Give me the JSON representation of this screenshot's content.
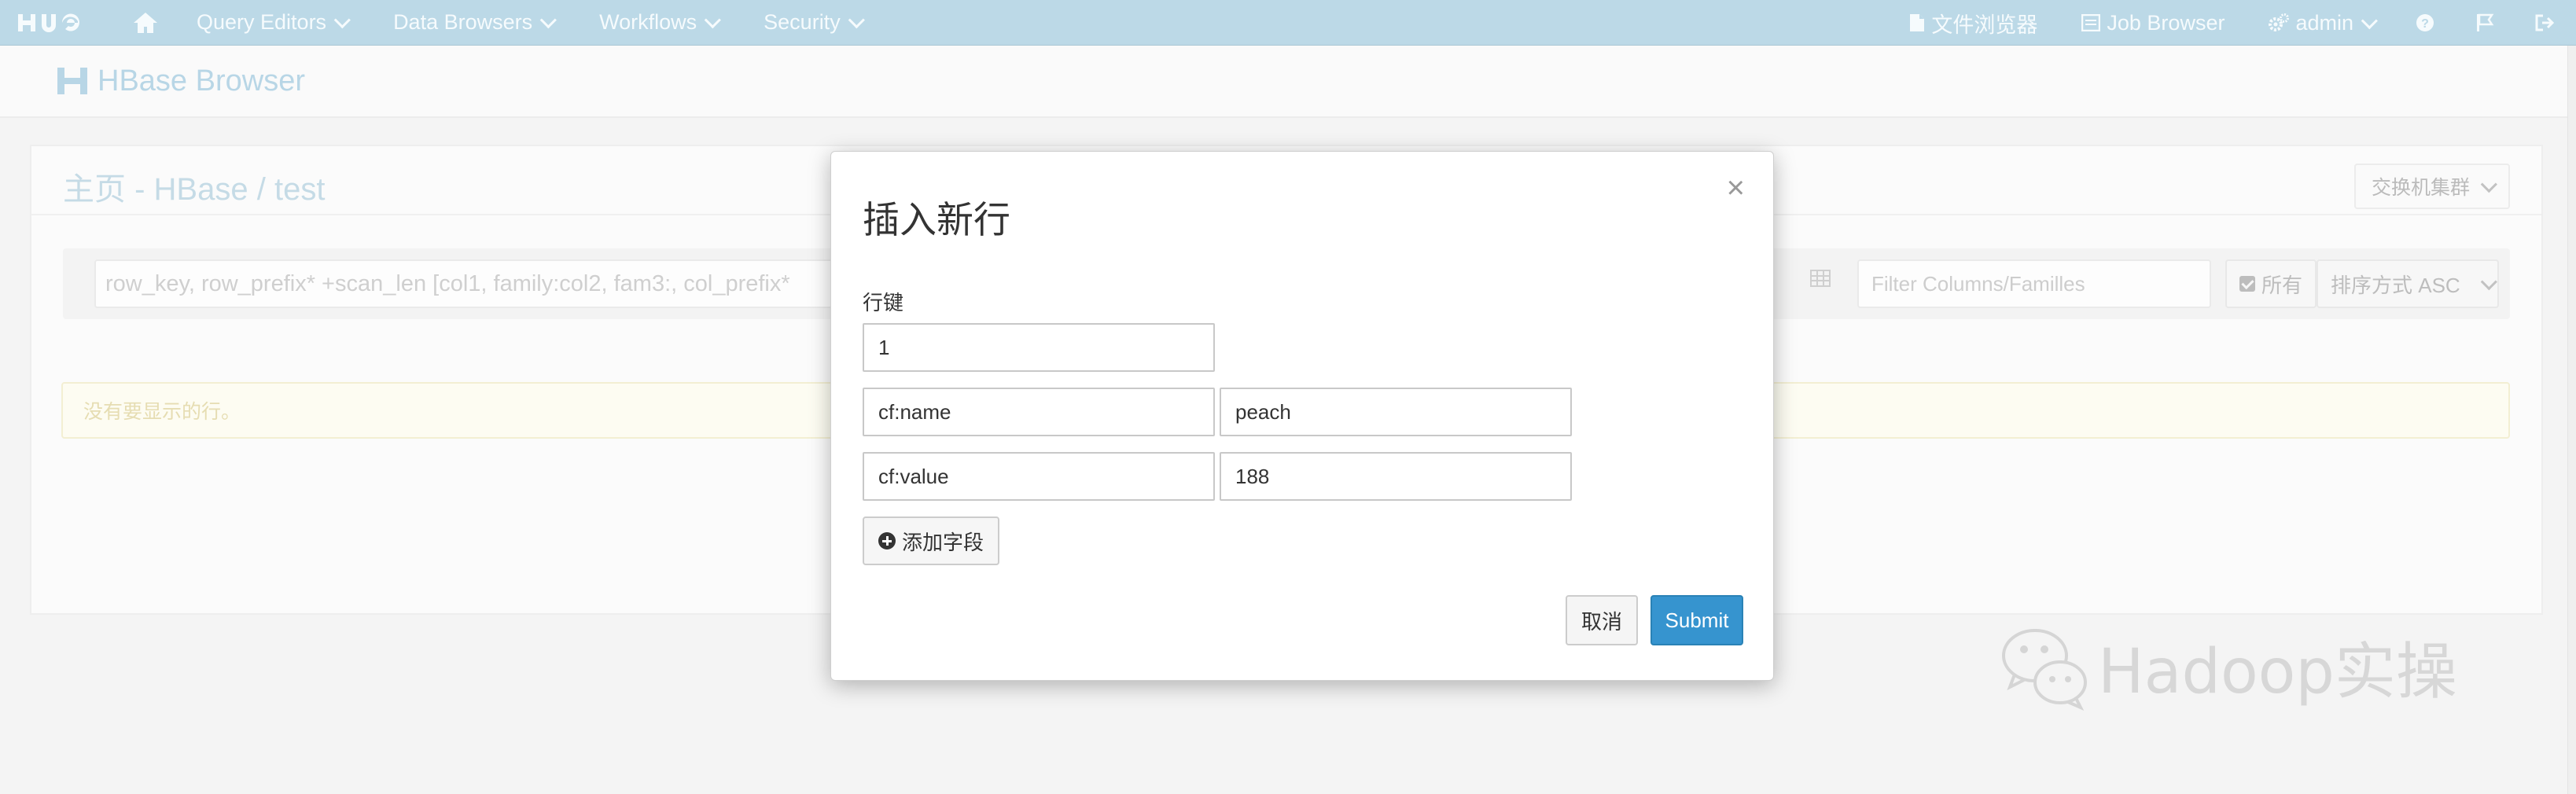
{
  "nav": {
    "brand": "HUE",
    "items": [
      {
        "label": "Query Editors"
      },
      {
        "label": "Data Browsers"
      },
      {
        "label": "Workflows"
      },
      {
        "label": "Security"
      }
    ],
    "right": {
      "file_browser": "文件浏览器",
      "job_browser": "Job Browser",
      "user": "admin"
    }
  },
  "app": {
    "title": "HBase Browser"
  },
  "breadcrumb": {
    "home": "主页",
    "dash": " - ",
    "hbase": "HBase",
    "slash": " / ",
    "table": "test"
  },
  "cluster_button": "交换机集群",
  "toolbar": {
    "row_query_placeholder": "row_key, row_prefix* +scan_len [col1, family:col2, fam3:, col_prefix*",
    "filter_placeholder": "Filter Columns/Familles",
    "all_label": "所有",
    "sort_label": "排序方式 ASC"
  },
  "alert": {
    "text": "没有要显示的行。"
  },
  "modal": {
    "title": "插入新行",
    "close": "×",
    "row_key_label": "行键",
    "row_key_value": "1",
    "fields": [
      {
        "column": "cf:name",
        "value": "peach"
      },
      {
        "column": "cf:value",
        "value": "188"
      }
    ],
    "add_field_label": "添加字段",
    "cancel_label": "取消",
    "submit_label": "Submit"
  },
  "watermark": {
    "text": "Hadoop实操"
  },
  "colors": {
    "nav_bg": "#bcd9e7",
    "primary": "#3694cf",
    "title_accent": "#b8d6e6"
  }
}
